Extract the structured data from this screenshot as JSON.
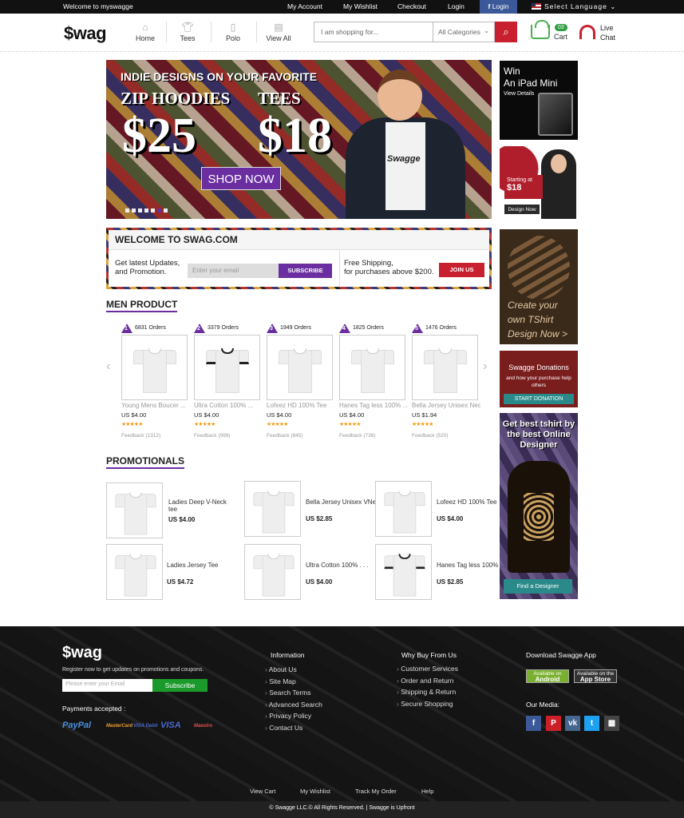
{
  "topbar": {
    "welcome": "Welcome to myswagge",
    "links": [
      "My Account",
      "My Wishlist",
      "Checkout",
      "Login"
    ],
    "login_btn": "Login",
    "language": "Select Language"
  },
  "header": {
    "logo": "$wag",
    "nav": [
      "Home",
      "Tees",
      "Polo",
      "View All"
    ],
    "search_placeholder": "I am shopping for...",
    "category": "All Categories",
    "cart_count": "03",
    "cart_label": "Cart",
    "chat_line1": "Live",
    "chat_line2": "Chat"
  },
  "banner": {
    "headline": "INDIE DESIGNS ON YOUR FAVORITE",
    "item1": "ZIP HOODIES",
    "item2": "TEES",
    "price1": "$25",
    "price2": "$18",
    "cta": "SHOP NOW",
    "brand": "Swagge"
  },
  "ads": {
    "ipad_line1": "Win",
    "ipad_line2": "An iPad Mini",
    "ipad_details": "View Details",
    "starting_at": "Starting at",
    "starting_price": "$18",
    "design_now": "Design Now",
    "create_line1": "Create your",
    "create_line2": "own TShirt",
    "create_line3": "Design Now >",
    "donation_title": "Swagge Donations",
    "donation_sub": "and how your purchase help others",
    "donation_btn": "START DONATION",
    "designer_text": "Get best tshirt by the best Online Designer",
    "designer_btn": "Find a Designer"
  },
  "welcome_box": {
    "title": "WELCOME TO SWAG.COM",
    "updates_line1": "Get latest Updates,",
    "updates_line2": "and Promotion.",
    "email_placeholder": "Enter your email",
    "subscribe": "SUBSCRIBE",
    "shipping_line1": "Free Shipping,",
    "shipping_line2": "for purchases above $200.",
    "join": "JOIN US"
  },
  "men_product": {
    "title": "MEN PRODUCT",
    "items": [
      {
        "rank": "1",
        "orders": "6831 Orders",
        "name": "Young Mens Boucer ...",
        "price": "US $4.00",
        "feedback": "Feedback (1312)",
        "ringer": false
      },
      {
        "rank": "2",
        "orders": "3379 Orders",
        "name": "Ultra Cotton 100% ...",
        "price": "US $4.00",
        "feedback": "Feedback (999)",
        "ringer": true
      },
      {
        "rank": "3",
        "orders": "1949 Orders",
        "name": "Lofeez HD 100% Tee",
        "price": "US $4.00",
        "feedback": "Feedback (845)",
        "ringer": false
      },
      {
        "rank": "4",
        "orders": "1825 Orders",
        "name": "Hanes Tag less 100% ...",
        "price": "US $4.00",
        "feedback": "Feedback (736)",
        "ringer": false
      },
      {
        "rank": "5",
        "orders": "1476 Orders",
        "name": "Bella Jersey Unisex Neck",
        "price": "US $1.94",
        "feedback": "Feedback (520)",
        "ringer": false
      }
    ],
    "rating": "★★★★★"
  },
  "promotionals": {
    "title": "PROMOTIONALS",
    "items": [
      {
        "name1": "Ladies Deep V-Neck",
        "name2": "tee",
        "price": "US $4.00"
      },
      {
        "name1": "Bella Jersey Unisex VNeck",
        "name2": "",
        "price": "US $2.85"
      },
      {
        "name1": "Lofeez HD 100% Tee",
        "name2": "",
        "price": "US $4.00"
      },
      {
        "name1": "Ladies Jersey Tee",
        "name2": "",
        "price": "US $4.72"
      },
      {
        "name1": "Ultra Cotton 100% . . .",
        "name2": "",
        "price": "US $4.00"
      },
      {
        "name1": "Hanes Tag less 100% ...",
        "name2": "",
        "price": "US $2.85"
      }
    ]
  },
  "footer": {
    "logo": "$wag",
    "register": "Register now to get updates on promotions and coupons.",
    "email_placeholder": "Please enter your Email",
    "subscribe": "Subscribe",
    "payments": "Payments accepted :",
    "payment_logos": [
      "PayPal",
      "MasterCard",
      "VISA Debit",
      "VISA",
      "Maestro"
    ],
    "info_title": "Information",
    "info_links": [
      "About Us",
      "Site Map",
      "Search Terms",
      "Advanced Search",
      "Privacy Policy",
      "Contact Us"
    ],
    "why_title": "Why Buy From Us",
    "why_links": [
      "Customer Services",
      "Order and Return",
      "Shipping & Return",
      "Secure Shopping"
    ],
    "app_title": "Download Swagge App",
    "android_small": "Available on",
    "android": "Android",
    "appstore_small": "Available on the",
    "appstore": "App Store",
    "media_title": "Our Media:",
    "bottom_links": [
      "View Cart",
      "My Wishlist",
      "Track My Order",
      "Help"
    ],
    "copyright": "© Swagge LLC.© All Rights Reserved. | Swagge is Upfront"
  },
  "colors": {
    "accent": "#6a2ea1",
    "red": "#c8202f",
    "green": "#1a9a2a"
  }
}
